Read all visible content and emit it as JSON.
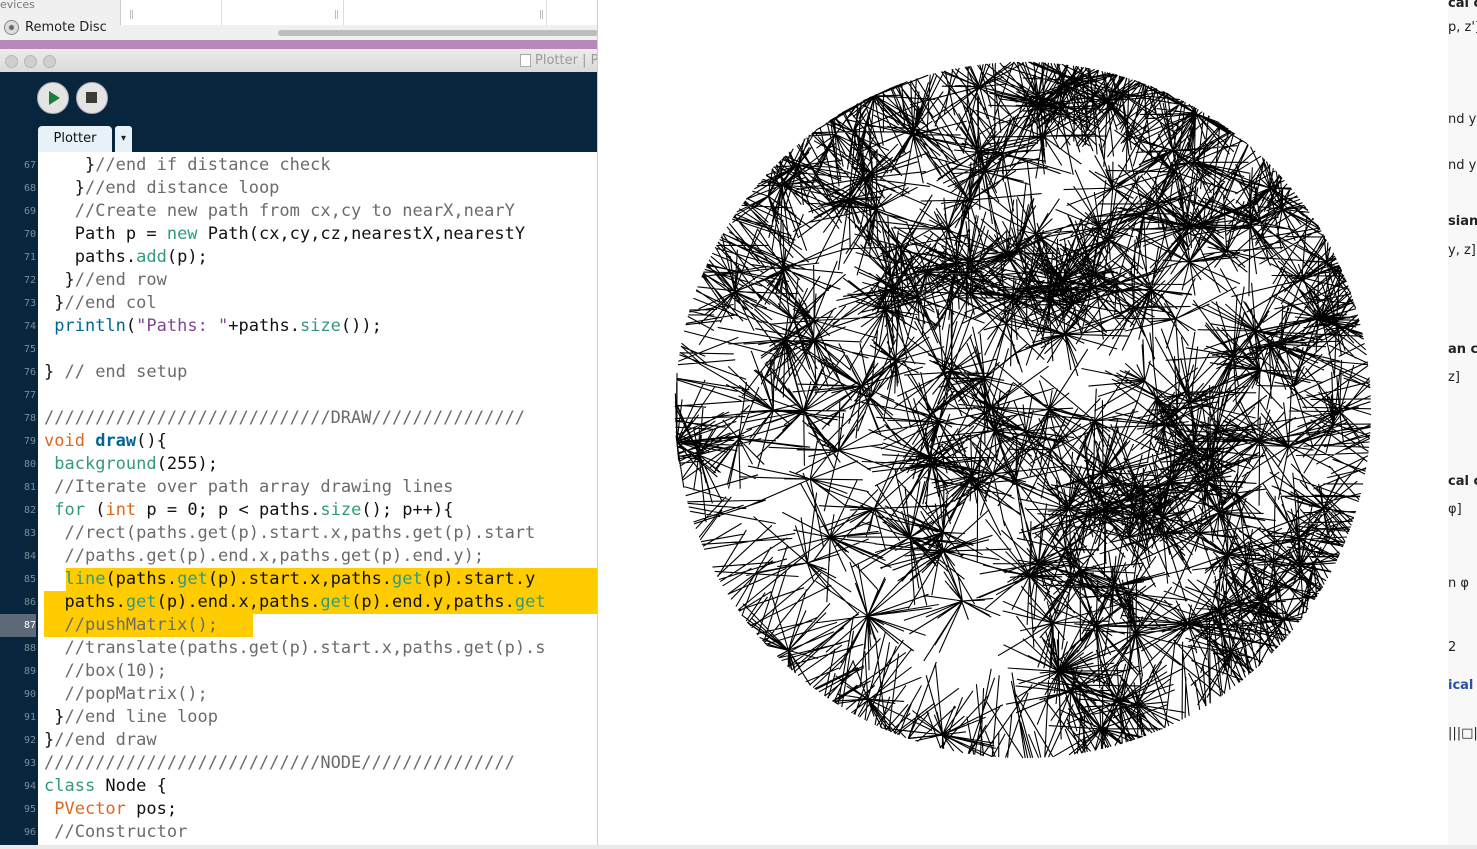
{
  "finder": {
    "section_label": "evices",
    "remote_disc_label": "Remote Disc",
    "column_handle": "||"
  },
  "window": {
    "title": "Plotter | P"
  },
  "toolbar": {
    "run_icon": "play-icon",
    "stop_icon": "stop-icon"
  },
  "tabs": {
    "active_label": "Plotter",
    "menu_glyph": "▾"
  },
  "editor": {
    "current_line": 87,
    "highlighted_lines": [
      85,
      86,
      87
    ],
    "lines": [
      {
        "n": "67",
        "text": "    }//end if distance check"
      },
      {
        "n": "68",
        "text": "   }//end distance loop"
      },
      {
        "n": "69",
        "text": "   //Create new path from cx,cy to nearX,nearY"
      },
      {
        "n": "70",
        "text": "   Path p = new Path(cx,cy,cz,nearestX,nearestY"
      },
      {
        "n": "71",
        "text": "   paths.add(p);"
      },
      {
        "n": "72",
        "text": "  }//end row"
      },
      {
        "n": "73",
        "text": " }//end col"
      },
      {
        "n": "74",
        "text": " println(\"Paths: \"+paths.size());"
      },
      {
        "n": "75",
        "text": ""
      },
      {
        "n": "76",
        "text": "} // end setup"
      },
      {
        "n": "77",
        "text": ""
      },
      {
        "n": "78",
        "text": "////////////////////////////DRAW///////////////"
      },
      {
        "n": "79",
        "text": "void draw(){"
      },
      {
        "n": "80",
        "text": " background(255);"
      },
      {
        "n": "81",
        "text": " //Iterate over path array drawing lines"
      },
      {
        "n": "82",
        "text": " for (int p = 0; p < paths.size(); p++){"
      },
      {
        "n": "83",
        "text": "  //rect(paths.get(p).start.x,paths.get(p).start"
      },
      {
        "n": "84",
        "text": "  //paths.get(p).end.x,paths.get(p).end.y);"
      },
      {
        "n": "85",
        "text": "  line(paths.get(p).start.x,paths.get(p).start.y"
      },
      {
        "n": "86",
        "text": "  paths.get(p).end.x,paths.get(p).end.y,paths.get"
      },
      {
        "n": "87",
        "text": "  //pushMatrix();"
      },
      {
        "n": "88",
        "text": "  //translate(paths.get(p).start.x,paths.get(p).s"
      },
      {
        "n": "89",
        "text": "  //box(10);"
      },
      {
        "n": "90",
        "text": "  //popMatrix();"
      },
      {
        "n": "91",
        "text": " }//end line loop"
      },
      {
        "n": "92",
        "text": "}//end draw"
      },
      {
        "n": "93",
        "text": "///////////////////////////NODE///////////////"
      },
      {
        "n": "94",
        "text": "class Node {"
      },
      {
        "n": "95",
        "text": " PVector pos;"
      },
      {
        "n": "96",
        "text": " //Constructor"
      }
    ]
  },
  "sketch": {
    "description_icon": "plot-output-canvas"
  },
  "right_panel": {
    "fragments": [
      "cal co",
      "p, z']",
      "nd y >",
      "nd y <",
      "sian c",
      "y, z]",
      "an co",
      "z]",
      "cal co",
      "φ]",
      "n φ",
      "2",
      "ical c",
      "|||□|"
    ]
  },
  "colors": {
    "editor_bg": "#ffffff",
    "gutter_bg": "#07253c",
    "highlight": "#ffcc00",
    "keyword": "#33997e",
    "type_keyword": "#e2661a",
    "function": "#006699",
    "comment": "#6b6b6b",
    "title_bar_purple": "#b889b8"
  }
}
